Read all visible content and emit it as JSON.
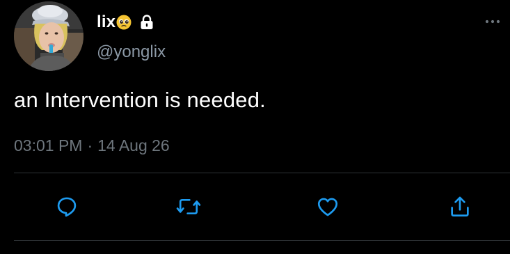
{
  "tweet": {
    "author": {
      "display_name": "lix",
      "name_emoji": "pleading-face-emoji",
      "locked_icon": "lock-icon",
      "handle": "@yonglix",
      "avatar": "profile-photo"
    },
    "text": "an Intervention is needed.",
    "meta": {
      "time": "03:01 PM",
      "separator": "·",
      "date": "14 Aug 26"
    },
    "more_icon": "more-horizontal-icon",
    "actions": [
      {
        "name": "reply",
        "icon": "reply-icon"
      },
      {
        "name": "retweet",
        "icon": "retweet-icon"
      },
      {
        "name": "like",
        "icon": "heart-icon"
      },
      {
        "name": "share",
        "icon": "share-icon"
      }
    ]
  },
  "colors": {
    "background": "#000000",
    "text": "#ffffff",
    "secondary": "#8b98a5",
    "meta": "#6e767d",
    "icon": "#1d9bf0",
    "divider": "#2f3336"
  }
}
